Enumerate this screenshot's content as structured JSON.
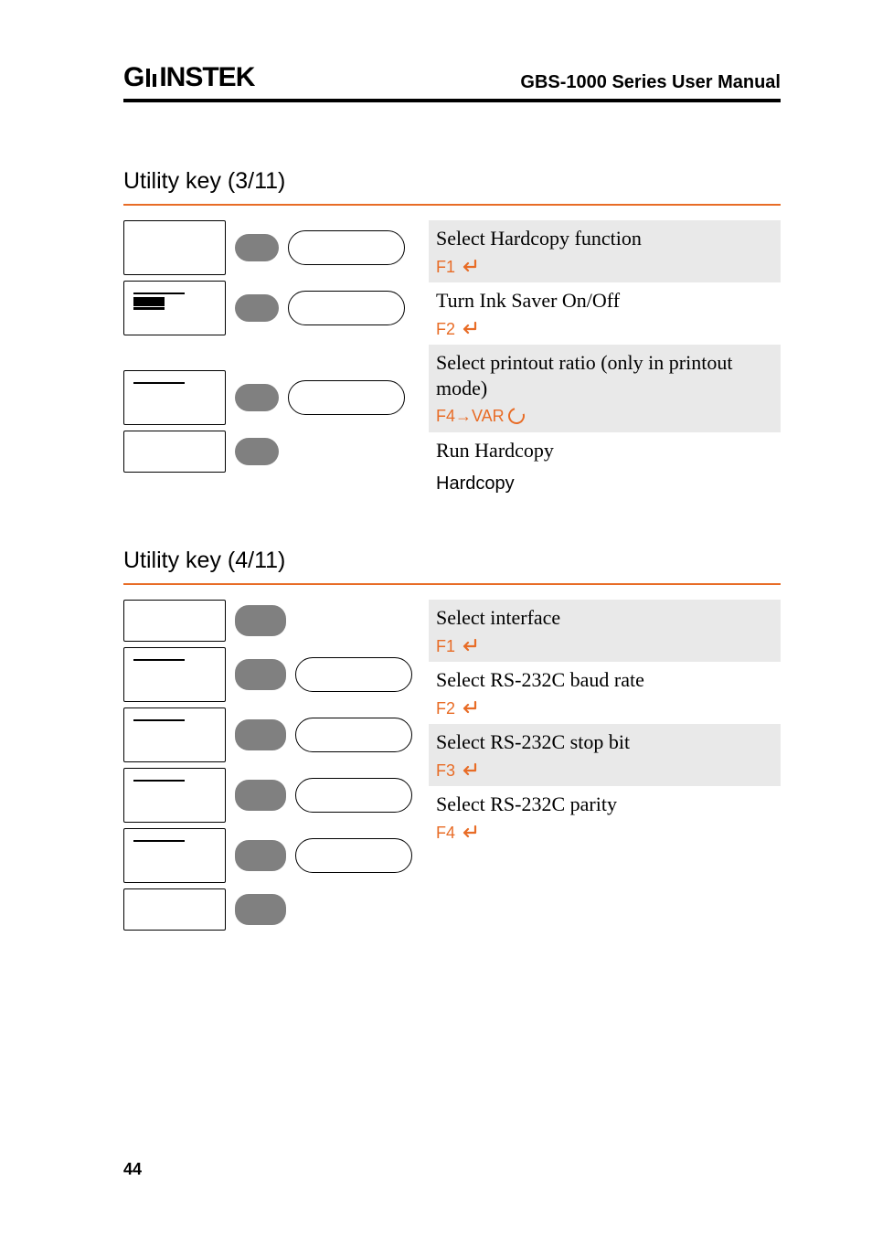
{
  "header": {
    "brand_left": "G",
    "brand_right": "INSTEK",
    "doc_title": "GBS-1000 Series User Manual"
  },
  "page_number": "44",
  "section1": {
    "title": "Utility key (3/11)",
    "items": [
      {
        "desc": "Select Hardcopy function",
        "control": "F1",
        "ctrl_type": "enter",
        "banded": true
      },
      {
        "desc": "Turn Ink Saver On/Off",
        "control": "F2",
        "ctrl_type": "enter",
        "banded": false
      },
      {
        "desc": "Select printout ratio (only in printout mode)",
        "control": "F4→VAR",
        "ctrl_type": "var",
        "banded": true
      },
      {
        "desc": "Run Hardcopy",
        "banded": false
      },
      {
        "desc": "Hardcopy",
        "banded": false,
        "plain": true
      }
    ]
  },
  "section2": {
    "title": "Utility key (4/11)",
    "items": [
      {
        "desc": "Select interface",
        "control": "F1",
        "ctrl_type": "enter",
        "banded": true
      },
      {
        "desc": "Select RS-232C baud rate",
        "control": "F2",
        "ctrl_type": "enter",
        "banded": false
      },
      {
        "desc": "Select RS-232C stop bit",
        "control": "F3",
        "ctrl_type": "enter",
        "banded": true
      },
      {
        "desc": "Select RS-232C parity",
        "control": "F4",
        "ctrl_type": "enter",
        "banded": false
      }
    ]
  }
}
